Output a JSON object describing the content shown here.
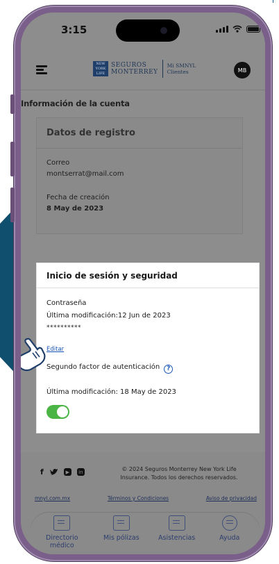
{
  "status": {
    "time": "3:15"
  },
  "header": {
    "brand_line1": "Seguros",
    "brand_line2": "Monterrey",
    "brand_sub1": "Mi SMNYL",
    "brand_sub2": "Clientes",
    "avatar_initials": "MB"
  },
  "account": {
    "title": "Información de la cuenta",
    "registration": {
      "title": "Datos de registro",
      "email_label": "Correo",
      "email_value": "montserrat@mail.com",
      "created_label": "Fecha de creación",
      "created_value": "8 May de 2023"
    },
    "security": {
      "title": "Inicio de sesión y seguridad",
      "password_label": "Contraseña",
      "password_modified": "Última modificación:12 Jun de 2023",
      "password_mask": "**********",
      "edit_link": "Editar",
      "two_factor_label": "Segundo factor de autenticación",
      "two_factor_help": "?",
      "two_factor_modified": "Última modificación: 18 May de 2023",
      "two_factor_enabled": true
    }
  },
  "footer": {
    "social": [
      "f",
      "twitter",
      "youtube",
      "in"
    ],
    "copyright_line1": "© 2024 Seguros Monterrey New York Life",
    "copyright_line2": "Insurance. Todos los derechos reservados.",
    "links": [
      "mnyl.com.mx",
      "Términos y Condiciones",
      "Aviso de privacidad"
    ]
  },
  "tabbar": {
    "items": [
      {
        "label_line1": "Directorio",
        "label_line2": "médico",
        "icon": "medical-directory-icon"
      },
      {
        "label_line1": "Mis pólizas",
        "label_line2": "",
        "icon": "policy-card-icon"
      },
      {
        "label_line1": "Asistencias",
        "label_line2": "",
        "icon": "assistance-icon"
      },
      {
        "label_line1": "Ayuda",
        "label_line2": "",
        "icon": "help-hand-icon"
      }
    ]
  },
  "colors": {
    "brand_navy": "#1e3555",
    "link_blue": "#1a56b8",
    "toggle_green": "#4ab545",
    "phone_frame": "#7a5f8a",
    "accent_teal": "#10506e"
  }
}
